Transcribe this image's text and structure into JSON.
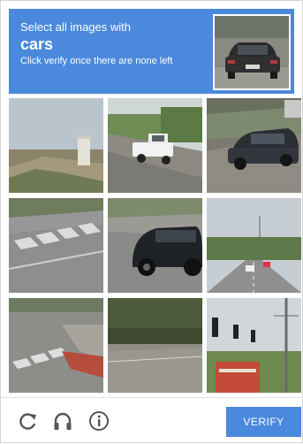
{
  "header": {
    "line1": "Select all images with",
    "target": "cars",
    "instruction": "Click verify once there are none left"
  },
  "tiles": [
    {
      "id": 1,
      "scene": "house-roof"
    },
    {
      "id": 2,
      "scene": "white-pickup-truck"
    },
    {
      "id": 3,
      "scene": "dark-car-parked"
    },
    {
      "id": 4,
      "scene": "crosswalk-road"
    },
    {
      "id": 5,
      "scene": "dark-suv"
    },
    {
      "id": 6,
      "scene": "road-with-cars"
    },
    {
      "id": 7,
      "scene": "crosswalk-corner"
    },
    {
      "id": 8,
      "scene": "road-hedge"
    },
    {
      "id": 9,
      "scene": "traffic-lights"
    }
  ],
  "footer": {
    "reload_icon": "reload-icon",
    "audio_icon": "headphones-icon",
    "info_icon": "info-icon",
    "verify_label": "VERIFY"
  },
  "colors": {
    "accent": "#4a89dc",
    "icon_gray": "#555555"
  }
}
